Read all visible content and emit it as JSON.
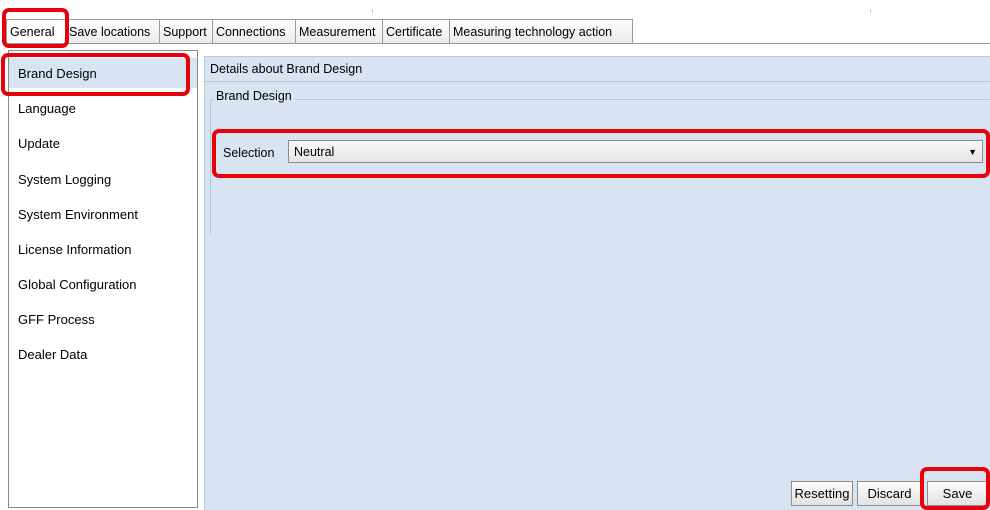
{
  "tabs": [
    {
      "label": "General",
      "active": true
    },
    {
      "label": "Save locations",
      "active": false
    },
    {
      "label": "Support",
      "active": false
    },
    {
      "label": "Connections",
      "active": false
    },
    {
      "label": "Measurement",
      "active": false
    },
    {
      "label": "Certificate",
      "active": false
    },
    {
      "label": "Measuring technology action",
      "active": false
    }
  ],
  "sidebar": {
    "items": [
      {
        "label": "Brand Design",
        "selected": true
      },
      {
        "label": "Language"
      },
      {
        "label": "Update"
      },
      {
        "label": "System Logging"
      },
      {
        "label": "System Environment"
      },
      {
        "label": "License Information"
      },
      {
        "label": "Global Configuration"
      },
      {
        "label": "GFF Process"
      },
      {
        "label": "Dealer Data"
      }
    ]
  },
  "details": {
    "header": "Details about Brand Design",
    "group_title": "Brand Design",
    "selection_label": "Selection",
    "selection_value": "Neutral"
  },
  "buttons": {
    "reset": "Resetting",
    "discard": "Discard",
    "save": "Save"
  },
  "colors": {
    "highlight": "#e8000b",
    "panel": "#d8e4f1",
    "selected_item": "#d7e4f2"
  }
}
